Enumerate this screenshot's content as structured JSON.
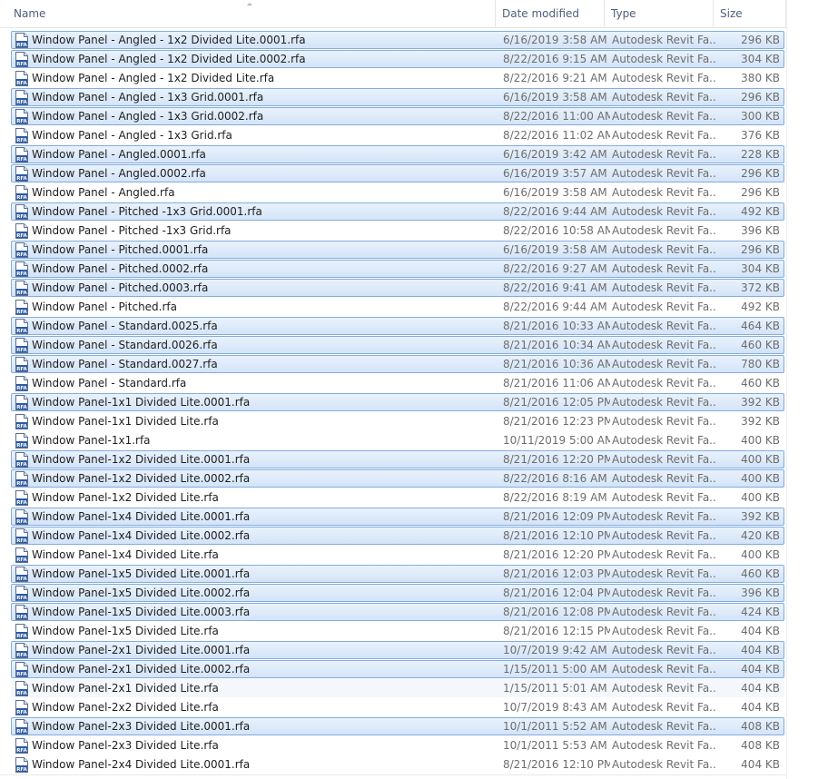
{
  "columns": {
    "name": "Name",
    "date": "Date modified",
    "type": "Type",
    "size": "Size"
  },
  "icon": "rfa-file-icon",
  "files": [
    {
      "name": "Window Panel - Angled - 1x2 Divided Lite.0001.rfa",
      "date": "6/16/2019 3:58 AM",
      "type": "Autodesk Revit Fa...",
      "size": "296 KB",
      "selected": true
    },
    {
      "name": "Window Panel - Angled - 1x2 Divided Lite.0002.rfa",
      "date": "8/22/2016 9:15 AM",
      "type": "Autodesk Revit Fa...",
      "size": "304 KB",
      "selected": true
    },
    {
      "name": "Window Panel - Angled - 1x2 Divided Lite.rfa",
      "date": "8/22/2016 9:21 AM",
      "type": "Autodesk Revit Fa...",
      "size": "380 KB",
      "selected": false
    },
    {
      "name": "Window Panel - Angled - 1x3 Grid.0001.rfa",
      "date": "6/16/2019 3:58 AM",
      "type": "Autodesk Revit Fa...",
      "size": "296 KB",
      "selected": true
    },
    {
      "name": "Window Panel - Angled - 1x3 Grid.0002.rfa",
      "date": "8/22/2016 11:00 AM",
      "type": "Autodesk Revit Fa...",
      "size": "300 KB",
      "selected": true
    },
    {
      "name": "Window Panel - Angled - 1x3 Grid.rfa",
      "date": "8/22/2016 11:02 AM",
      "type": "Autodesk Revit Fa...",
      "size": "376 KB",
      "selected": false
    },
    {
      "name": "Window Panel - Angled.0001.rfa",
      "date": "6/16/2019 3:42 AM",
      "type": "Autodesk Revit Fa...",
      "size": "228 KB",
      "selected": true
    },
    {
      "name": "Window Panel - Angled.0002.rfa",
      "date": "6/16/2019 3:57 AM",
      "type": "Autodesk Revit Fa...",
      "size": "296 KB",
      "selected": true
    },
    {
      "name": "Window Panel - Angled.rfa",
      "date": "6/16/2019 3:58 AM",
      "type": "Autodesk Revit Fa...",
      "size": "296 KB",
      "selected": false
    },
    {
      "name": "Window Panel - Pitched -1x3 Grid.0001.rfa",
      "date": "8/22/2016 9:44 AM",
      "type": "Autodesk Revit Fa...",
      "size": "492 KB",
      "selected": true
    },
    {
      "name": "Window Panel - Pitched -1x3 Grid.rfa",
      "date": "8/22/2016 10:58 AM",
      "type": "Autodesk Revit Fa...",
      "size": "396 KB",
      "selected": false
    },
    {
      "name": "Window Panel - Pitched.0001.rfa",
      "date": "6/16/2019 3:58 AM",
      "type": "Autodesk Revit Fa...",
      "size": "296 KB",
      "selected": true
    },
    {
      "name": "Window Panel - Pitched.0002.rfa",
      "date": "8/22/2016 9:27 AM",
      "type": "Autodesk Revit Fa...",
      "size": "304 KB",
      "selected": true
    },
    {
      "name": "Window Panel - Pitched.0003.rfa",
      "date": "8/22/2016 9:41 AM",
      "type": "Autodesk Revit Fa...",
      "size": "372 KB",
      "selected": true
    },
    {
      "name": "Window Panel - Pitched.rfa",
      "date": "8/22/2016 9:44 AM",
      "type": "Autodesk Revit Fa...",
      "size": "492 KB",
      "selected": false
    },
    {
      "name": "Window Panel - Standard.0025.rfa",
      "date": "8/21/2016 10:33 AM",
      "type": "Autodesk Revit Fa...",
      "size": "464 KB",
      "selected": true
    },
    {
      "name": "Window Panel - Standard.0026.rfa",
      "date": "8/21/2016 10:34 AM",
      "type": "Autodesk Revit Fa...",
      "size": "460 KB",
      "selected": true
    },
    {
      "name": "Window Panel - Standard.0027.rfa",
      "date": "8/21/2016 10:36 AM",
      "type": "Autodesk Revit Fa...",
      "size": "780 KB",
      "selected": true
    },
    {
      "name": "Window Panel - Standard.rfa",
      "date": "8/21/2016 11:06 AM",
      "type": "Autodesk Revit Fa...",
      "size": "460 KB",
      "selected": false
    },
    {
      "name": "Window Panel-1x1 Divided Lite.0001.rfa",
      "date": "8/21/2016 12:05 PM",
      "type": "Autodesk Revit Fa...",
      "size": "392 KB",
      "selected": true
    },
    {
      "name": "Window Panel-1x1 Divided Lite.rfa",
      "date": "8/21/2016 12:23 PM",
      "type": "Autodesk Revit Fa...",
      "size": "392 KB",
      "selected": false
    },
    {
      "name": "Window Panel-1x1.rfa",
      "date": "10/11/2019 5:00 AM",
      "type": "Autodesk Revit Fa...",
      "size": "400 KB",
      "selected": false
    },
    {
      "name": "Window Panel-1x2 Divided Lite.0001.rfa",
      "date": "8/21/2016 12:20 PM",
      "type": "Autodesk Revit Fa...",
      "size": "400 KB",
      "selected": true
    },
    {
      "name": "Window Panel-1x2 Divided Lite.0002.rfa",
      "date": "8/22/2016 8:16 AM",
      "type": "Autodesk Revit Fa...",
      "size": "400 KB",
      "selected": true
    },
    {
      "name": "Window Panel-1x2 Divided Lite.rfa",
      "date": "8/22/2016 8:19 AM",
      "type": "Autodesk Revit Fa...",
      "size": "400 KB",
      "selected": false
    },
    {
      "name": "Window Panel-1x4 Divided Lite.0001.rfa",
      "date": "8/21/2016 12:09 PM",
      "type": "Autodesk Revit Fa...",
      "size": "392 KB",
      "selected": true
    },
    {
      "name": "Window Panel-1x4 Divided Lite.0002.rfa",
      "date": "8/21/2016 12:10 PM",
      "type": "Autodesk Revit Fa...",
      "size": "420 KB",
      "selected": true
    },
    {
      "name": "Window Panel-1x4 Divided Lite.rfa",
      "date": "8/21/2016 12:20 PM",
      "type": "Autodesk Revit Fa...",
      "size": "400 KB",
      "selected": false
    },
    {
      "name": "Window Panel-1x5 Divided Lite.0001.rfa",
      "date": "8/21/2016 12:03 PM",
      "type": "Autodesk Revit Fa...",
      "size": "460 KB",
      "selected": true
    },
    {
      "name": "Window Panel-1x5 Divided Lite.0002.rfa",
      "date": "8/21/2016 12:04 PM",
      "type": "Autodesk Revit Fa...",
      "size": "396 KB",
      "selected": true
    },
    {
      "name": "Window Panel-1x5 Divided Lite.0003.rfa",
      "date": "8/21/2016 12:08 PM",
      "type": "Autodesk Revit Fa...",
      "size": "424 KB",
      "selected": true
    },
    {
      "name": "Window Panel-1x5 Divided Lite.rfa",
      "date": "8/21/2016 12:15 PM",
      "type": "Autodesk Revit Fa...",
      "size": "404 KB",
      "selected": false
    },
    {
      "name": "Window Panel-2x1 Divided Lite.0001.rfa",
      "date": "10/7/2019 9:42 AM",
      "type": "Autodesk Revit Fa...",
      "size": "404 KB",
      "selected": true
    },
    {
      "name": "Window Panel-2x1 Divided Lite.0002.rfa",
      "date": "1/15/2011 5:00 AM",
      "type": "Autodesk Revit Fa...",
      "size": "404 KB",
      "selected": true
    },
    {
      "name": "Window Panel-2x1 Divided Lite.rfa",
      "date": "1/15/2011 5:01 AM",
      "type": "Autodesk Revit Fa...",
      "size": "404 KB",
      "selected": false,
      "faint": true
    },
    {
      "name": "Window Panel-2x2 Divided Lite.rfa",
      "date": "10/7/2019 8:43 AM",
      "type": "Autodesk Revit Fa...",
      "size": "404 KB",
      "selected": false
    },
    {
      "name": "Window Panel-2x3 Divided Lite.0001.rfa",
      "date": "10/1/2011 5:52 AM",
      "type": "Autodesk Revit Fa...",
      "size": "408 KB",
      "selected": true
    },
    {
      "name": "Window Panel-2x3 Divided Lite.rfa",
      "date": "10/1/2011 5:53 AM",
      "type": "Autodesk Revit Fa...",
      "size": "408 KB",
      "selected": false
    },
    {
      "name": "Window Panel-2x4 Divided Lite.0001.rfa",
      "date": "8/21/2016 12:10 PM",
      "type": "Autodesk Revit Fa...",
      "size": "404 KB",
      "selected": false
    }
  ],
  "colors": {
    "selection_fill": "#d3e4f8",
    "selection_border": "#84acdd",
    "header_text": "#4c607a",
    "secondary_text": "#6d6d6d"
  }
}
